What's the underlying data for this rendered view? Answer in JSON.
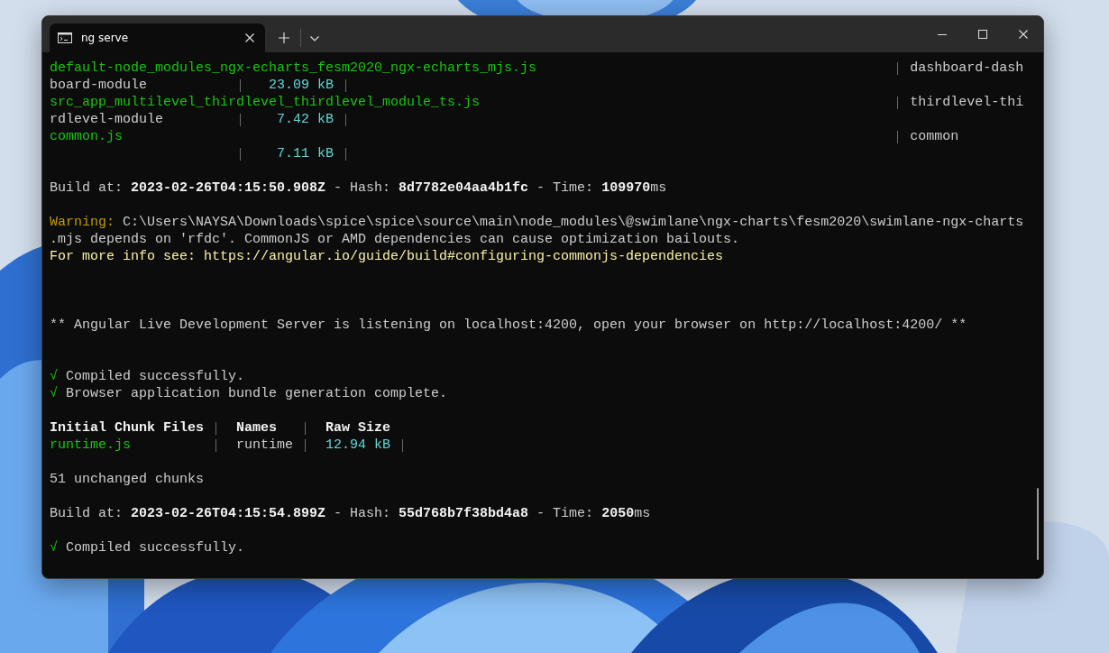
{
  "tabs": [
    {
      "title": "ng serve",
      "selected": true
    }
  ],
  "terminal": {
    "lines": [
      {
        "kind": "file",
        "file": "default-node_modules_ngx-echarts_fesm2020_ngx-echarts_mjs.js",
        "names": "dashboard-dash"
      },
      {
        "kind": "size",
        "names": "board-module",
        "size": "23.09 kB"
      },
      {
        "kind": "file",
        "file": "src_app_multilevel_thirdlevel_thirdlevel_module_ts.js",
        "names": "thirdlevel-thi"
      },
      {
        "kind": "size",
        "names": "rdlevel-module",
        "size": "7.42 kB"
      },
      {
        "kind": "file",
        "file": "common.js",
        "names": "common"
      },
      {
        "kind": "size",
        "size": "7.11 kB"
      },
      {
        "kind": "blank"
      },
      {
        "kind": "build",
        "text": "Build at: **2023-02-26T04:15:50.908Z** - Hash: **8d7782e04aa4b1fc** - Time: **109970**ms"
      },
      {
        "kind": "blank"
      },
      {
        "kind": "warning",
        "label": "Warning:",
        "text": "C:\\Users\\NAYSA\\Downloads\\spice\\spice\\source\\main\\node_modules\\@swimlane\\ngx-charts\\fesm2020\\swimlane-ngx-charts"
      },
      {
        "kind": "plain",
        "text": ".mjs depends on 'rfdc'. CommonJS or AMD dependencies can cause optimization bailouts."
      },
      {
        "kind": "info",
        "text": "For more info see: https://angular.io/guide/build#configuring-commonjs-dependencies"
      },
      {
        "kind": "blank"
      },
      {
        "kind": "blank"
      },
      {
        "kind": "blank"
      },
      {
        "kind": "plain",
        "text": "** Angular Live Development Server is listening on localhost:4200, open your browser on http://localhost:4200/ **"
      },
      {
        "kind": "blank"
      },
      {
        "kind": "blank"
      },
      {
        "kind": "check",
        "mark": "√",
        "text": "Compiled successfully."
      },
      {
        "kind": "check",
        "mark": "√",
        "text": "Browser application bundle generation complete."
      },
      {
        "kind": "blank"
      },
      {
        "kind": "table_header",
        "cells": [
          "Initial Chunk Files",
          "Names",
          "Raw Size"
        ]
      },
      {
        "kind": "table_row",
        "cells": [
          "runtime.js",
          "runtime",
          "12.94 kB"
        ]
      },
      {
        "kind": "blank"
      },
      {
        "kind": "plain",
        "text": "51 unchanged chunks"
      },
      {
        "kind": "blank"
      },
      {
        "kind": "build",
        "text": "Build at: **2023-02-26T04:15:54.899Z** - Hash: **55d768b7f38bd4a8** - Time: **2050**ms"
      },
      {
        "kind": "blank"
      },
      {
        "kind": "check",
        "mark": "√",
        "text": "Compiled successfully."
      }
    ]
  }
}
